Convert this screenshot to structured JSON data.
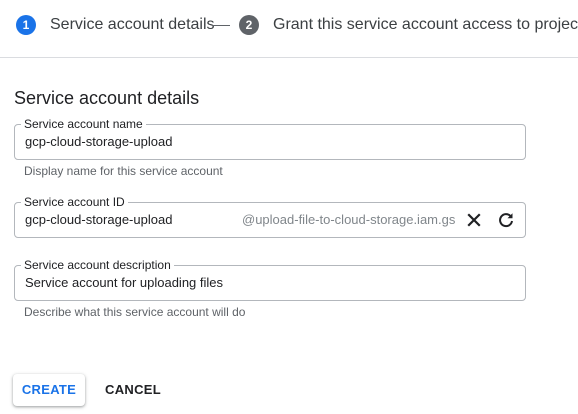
{
  "stepper": {
    "steps": [
      {
        "number": "1",
        "label": "Service account details",
        "state": "active"
      },
      {
        "number": "2",
        "label": "Grant this service account access to project (o",
        "state": "inactive"
      }
    ],
    "connector": "—"
  },
  "section": {
    "title": "Service account details"
  },
  "fields": {
    "name": {
      "label": "Service account name",
      "value": "gcp-cloud-storage-upload",
      "hint": "Display name for this service account"
    },
    "id": {
      "label": "Service account ID",
      "value": "gcp-cloud-storage-upload",
      "suffix": "@upload-file-to-cloud-storage.iam.gs",
      "icons": [
        "close-icon",
        "refresh-icon"
      ]
    },
    "description": {
      "label": "Service account description",
      "value": "Service account for uploading files",
      "hint": "Describe what this service account will do"
    }
  },
  "actions": {
    "create_label": "CREATE",
    "cancel_label": "CANCEL"
  },
  "colors": {
    "accent": "#1a73e8",
    "inactive_step": "#5f6368",
    "border": "#b3b7bc",
    "hint": "#5f6368"
  }
}
